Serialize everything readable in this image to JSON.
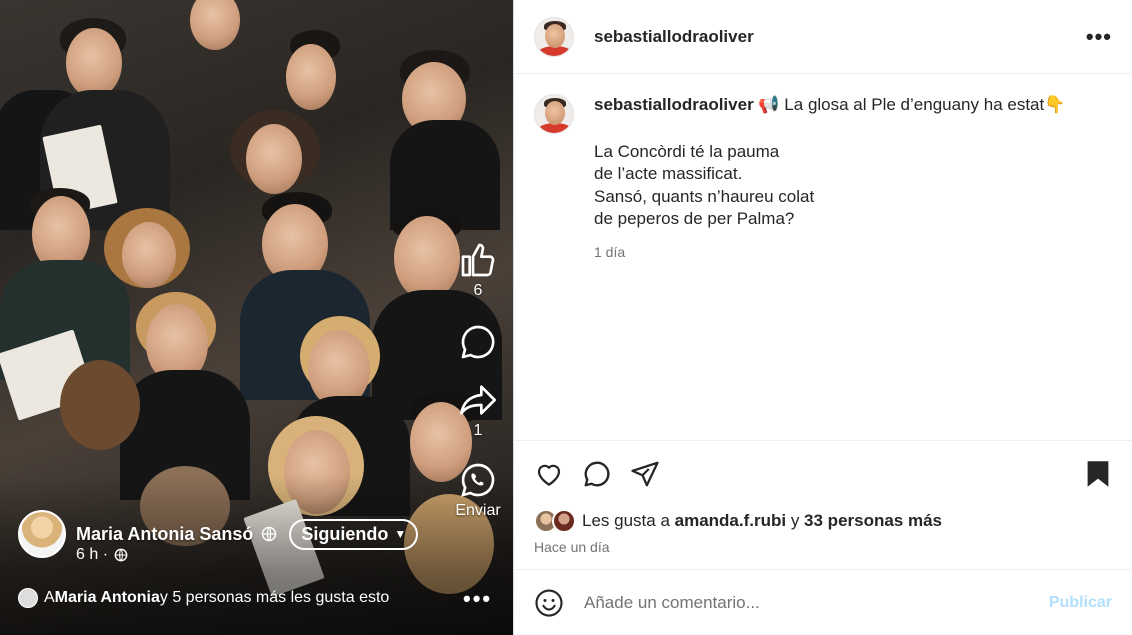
{
  "post": {
    "username": "sebastiallodraoliver",
    "more_icon": "more-horizontal-icon",
    "caption_username": "sebastiallodraoliver",
    "caption_intro": "📢 La glosa al Ple d’enguany ha estat👇",
    "caption_lines": [
      "La Concòrdi té la pauma",
      "de l’acte massificat.",
      "Sansó, quants n’haureu colat",
      "de peperos de per Palma?"
    ],
    "caption_time": "1 día",
    "likes_text_prefix": "Les gusta a ",
    "likes_user": "amanda.f.rubi",
    "likes_text_mid": " y ",
    "likes_others": "33 personas más",
    "since": "Hace un día",
    "comment_placeholder": "Añade un comentario...",
    "publish_label": "Publicar"
  },
  "media": {
    "author_name": "Maria Antonia Sansó",
    "follow_label": "Siguiendo",
    "meta_time": "6 h ·",
    "likes_line_prefix": "A ",
    "likes_line_user": "Maria Antonia",
    "likes_line_suffix": " y 5 personas más les gusta esto",
    "like_count": "6",
    "share_count": "1",
    "send_label": "Enviar"
  },
  "colors": {
    "accent_publish": "#b2dffc",
    "text_primary": "#262626",
    "text_secondary": "#737373"
  }
}
